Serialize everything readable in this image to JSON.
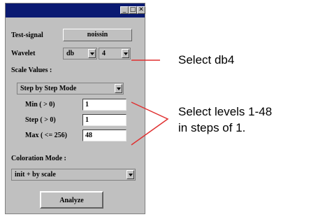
{
  "window": {
    "controls": {
      "minimize": "_",
      "maximize": "□",
      "close": "✕"
    }
  },
  "test_signal": {
    "label": "Test-signal",
    "value": "noissin"
  },
  "wavelet": {
    "label": "Wavelet",
    "family": "db",
    "order": "4"
  },
  "scale": {
    "label": "Scale Values :",
    "mode": "Step by Step Mode",
    "min_label": "Min  ( > 0)",
    "min_value": "1",
    "step_label": "Step ( > 0)",
    "step_value": "1",
    "max_label": "Max  ( <= 256)",
    "max_value": "48"
  },
  "coloration": {
    "label": "Coloration Mode :",
    "value": "init + by scale"
  },
  "analyze_label": "Analyze",
  "annotations": {
    "db4": "Select db4",
    "levels_line1": "Select levels 1-48",
    "levels_line2": "in steps of 1."
  },
  "colors": {
    "titlebar": "#0a1a72",
    "annotation_line": "#e03030",
    "panel": "#c0c0c0"
  }
}
